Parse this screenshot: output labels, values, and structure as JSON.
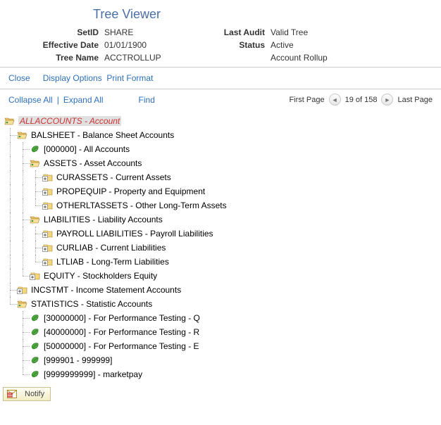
{
  "title": "Tree Viewer",
  "meta": {
    "setid_label": "SetID",
    "setid_value": "SHARE",
    "last_audit_label": "Last Audit",
    "last_audit_value": "Valid Tree",
    "effective_date_label": "Effective Date",
    "effective_date_value": "01/01/1900",
    "status_label": "Status",
    "status_value": "Active",
    "tree_name_label": "Tree Name",
    "tree_name_value": "ACCTROLLUP",
    "description": "Account Rollup"
  },
  "toolbar": {
    "close": "Close",
    "display_options": "Display Options",
    "print_format": "Print Format"
  },
  "controls": {
    "collapse_all": "Collapse All",
    "expand_all": "Expand All",
    "find": "Find",
    "first_page": "First Page",
    "page_info": "19 of 158",
    "last_page": "Last Page"
  },
  "tree": [
    {
      "depth": 0,
      "icon": "folder-open",
      "label": "ALLACCOUNTS - Account",
      "root": true,
      "guides": ""
    },
    {
      "depth": 1,
      "icon": "folder-open",
      "label": "BALSHEET - Balance Sheet Accounts",
      "guides": "t"
    },
    {
      "depth": 2,
      "icon": "leaf",
      "label": "[000000] - All Accounts",
      "guides": "lt"
    },
    {
      "depth": 2,
      "icon": "folder-open",
      "label": "ASSETS - Asset Accounts",
      "guides": "lt"
    },
    {
      "depth": 3,
      "icon": "folder-plus",
      "label": "CURASSETS - Current Assets",
      "guides": "llt"
    },
    {
      "depth": 3,
      "icon": "folder-plus",
      "label": "PROPEQUIP - Property and Equipment",
      "guides": "llt"
    },
    {
      "depth": 3,
      "icon": "folder-plus",
      "label": "OTHERLTASSETS - Other Long-Term Assets",
      "guides": "lle"
    },
    {
      "depth": 2,
      "icon": "folder-open",
      "label": "LIABILITIES - Liability Accounts",
      "guides": "lt"
    },
    {
      "depth": 3,
      "icon": "folder-plus",
      "label": "PAYROLL LIABILITIES - Payroll Liabilities",
      "guides": "llt"
    },
    {
      "depth": 3,
      "icon": "folder-plus",
      "label": "CURLIAB - Current Liabilities",
      "guides": "llt"
    },
    {
      "depth": 3,
      "icon": "folder-plus",
      "label": "LTLIAB - Long-Term Liabilities",
      "guides": "lle"
    },
    {
      "depth": 2,
      "icon": "folder-plus",
      "label": "EQUITY - Stockholders Equity",
      "guides": "le"
    },
    {
      "depth": 1,
      "icon": "folder-plus",
      "label": "INCSTMT - Income Statement Accounts",
      "guides": "t"
    },
    {
      "depth": 1,
      "icon": "folder-open",
      "label": "STATISTICS - Statistic Accounts",
      "guides": "e"
    },
    {
      "depth": 2,
      "icon": "leaf",
      "label": "[30000000] - For Performance Testing - Q",
      "guides": "bt"
    },
    {
      "depth": 2,
      "icon": "leaf",
      "label": "[40000000] - For Performance Testing - R",
      "guides": "bt"
    },
    {
      "depth": 2,
      "icon": "leaf",
      "label": "[50000000] - For Performance Testing - E",
      "guides": "bt"
    },
    {
      "depth": 2,
      "icon": "leaf",
      "label": "[999901 - 999999]",
      "guides": "bt"
    },
    {
      "depth": 2,
      "icon": "leaf",
      "label": "[9999999999] - marketpay",
      "guides": "be"
    }
  ],
  "footer": {
    "notify": "Notify"
  }
}
